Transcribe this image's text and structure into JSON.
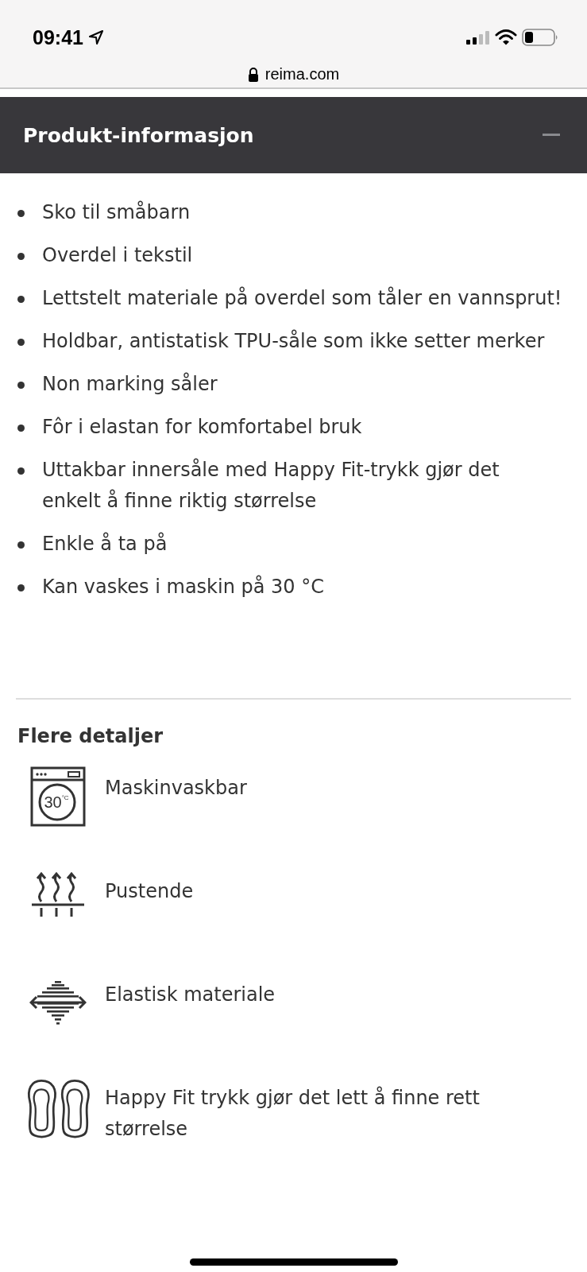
{
  "status_bar": {
    "time": "09:41",
    "url": "reima.com"
  },
  "section": {
    "title": "Produkt-informasjon",
    "expanded": true
  },
  "features": [
    "Sko til småbarn",
    "Overdel i tekstil",
    "Lettstelt materiale på overdel som tåler en vannsprut!",
    "Holdbar, antistatisk TPU-såle som ikke setter merker",
    "Non marking såler",
    "Fôr i elastan for komfortabel bruk",
    "Uttakbar innersåle med Happy Fit-trykk gjør det enkelt å finne riktig størrelse",
    "Enkle å ta på",
    "Kan vaskes i maskin på 30 °C"
  ],
  "details": {
    "title": "Flere detaljer",
    "items": [
      {
        "kind": "wash",
        "icon_text": "30",
        "icon_unit": "°C",
        "label": "Maskinvaskbar"
      },
      {
        "kind": "breathable",
        "label": "Pustende"
      },
      {
        "kind": "stretch",
        "label": "Elastisk materiale"
      },
      {
        "kind": "insole",
        "label": "Happy Fit trykk gjør det lett å finne rett størrelse"
      }
    ]
  }
}
